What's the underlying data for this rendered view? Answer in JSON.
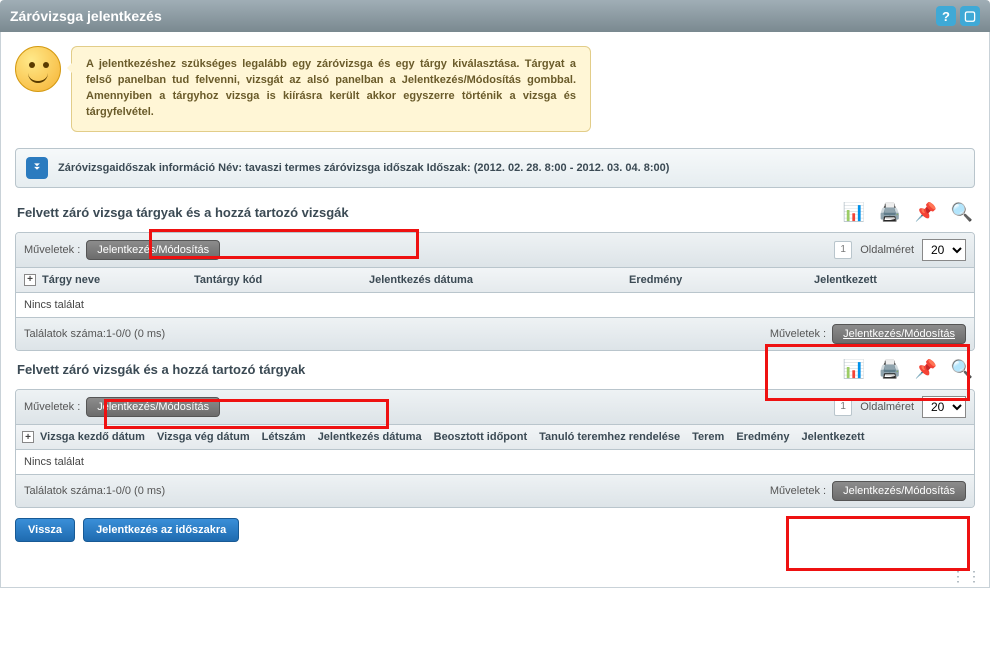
{
  "title": "Záróvizsga jelentkezés",
  "hint": "A jelentkezéshez szükséges legalább egy záróvizsga és egy tárgy kiválasztása. Tárgyat a felső panelban tud felvenni, vizsgát az alsó panelban a Jelentkezés/Módosítás gombbal. Amennyiben a tárgyhoz vizsga is kiírásra került akkor egyszerre történik a vizsga és tárgyfelvétel.",
  "period_info": "Záróvizsgaidőszak információ Név: tavaszi termes záróvizsga időszak Időszak: (2012. 02. 28. 8:00 - 2012. 03. 04. 8:00)",
  "sections": [
    {
      "title": "Felvett záró vizsga tárgyak és a hozzá tartozó vizsgák",
      "ops_label": "Műveletek :",
      "ops_button": "Jelentkezés/Módosítás",
      "pager": {
        "page": "1",
        "size_label": "Oldalméret",
        "size_value": "20"
      },
      "columns": [
        "Tárgy neve",
        "Tantárgy kód",
        "Jelentkezés dátuma",
        "Eredmény",
        "Jelentkezett"
      ],
      "empty": "Nincs találat",
      "footer_count": "Találatok száma:1-0/0 (0 ms)",
      "footer_ops_label": "Műveletek :",
      "footer_button": "Jelentkezés/Módosítás"
    },
    {
      "title": "Felvett záró vizsgák és a hozzá tartozó tárgyak",
      "ops_label": "Műveletek :",
      "ops_button": "Jelentkezés/Módosítás",
      "pager": {
        "page": "1",
        "size_label": "Oldalméret",
        "size_value": "20"
      },
      "columns": [
        "Vizsga kezdő dátum",
        "Vizsga vég dátum",
        "Létszám",
        "Jelentkezés dátuma",
        "Beosztott időpont",
        "Tanuló teremhez rendelése",
        "Terem",
        "Eredmény",
        "Jelentkezett"
      ],
      "empty": "Nincs találat",
      "footer_count": "Találatok száma:1-0/0 (0 ms)",
      "footer_ops_label": "Műveletek :",
      "footer_button": "Jelentkezés/Módosítás"
    }
  ],
  "buttons": {
    "back": "Vissza",
    "apply": "Jelentkezés az időszakra"
  }
}
